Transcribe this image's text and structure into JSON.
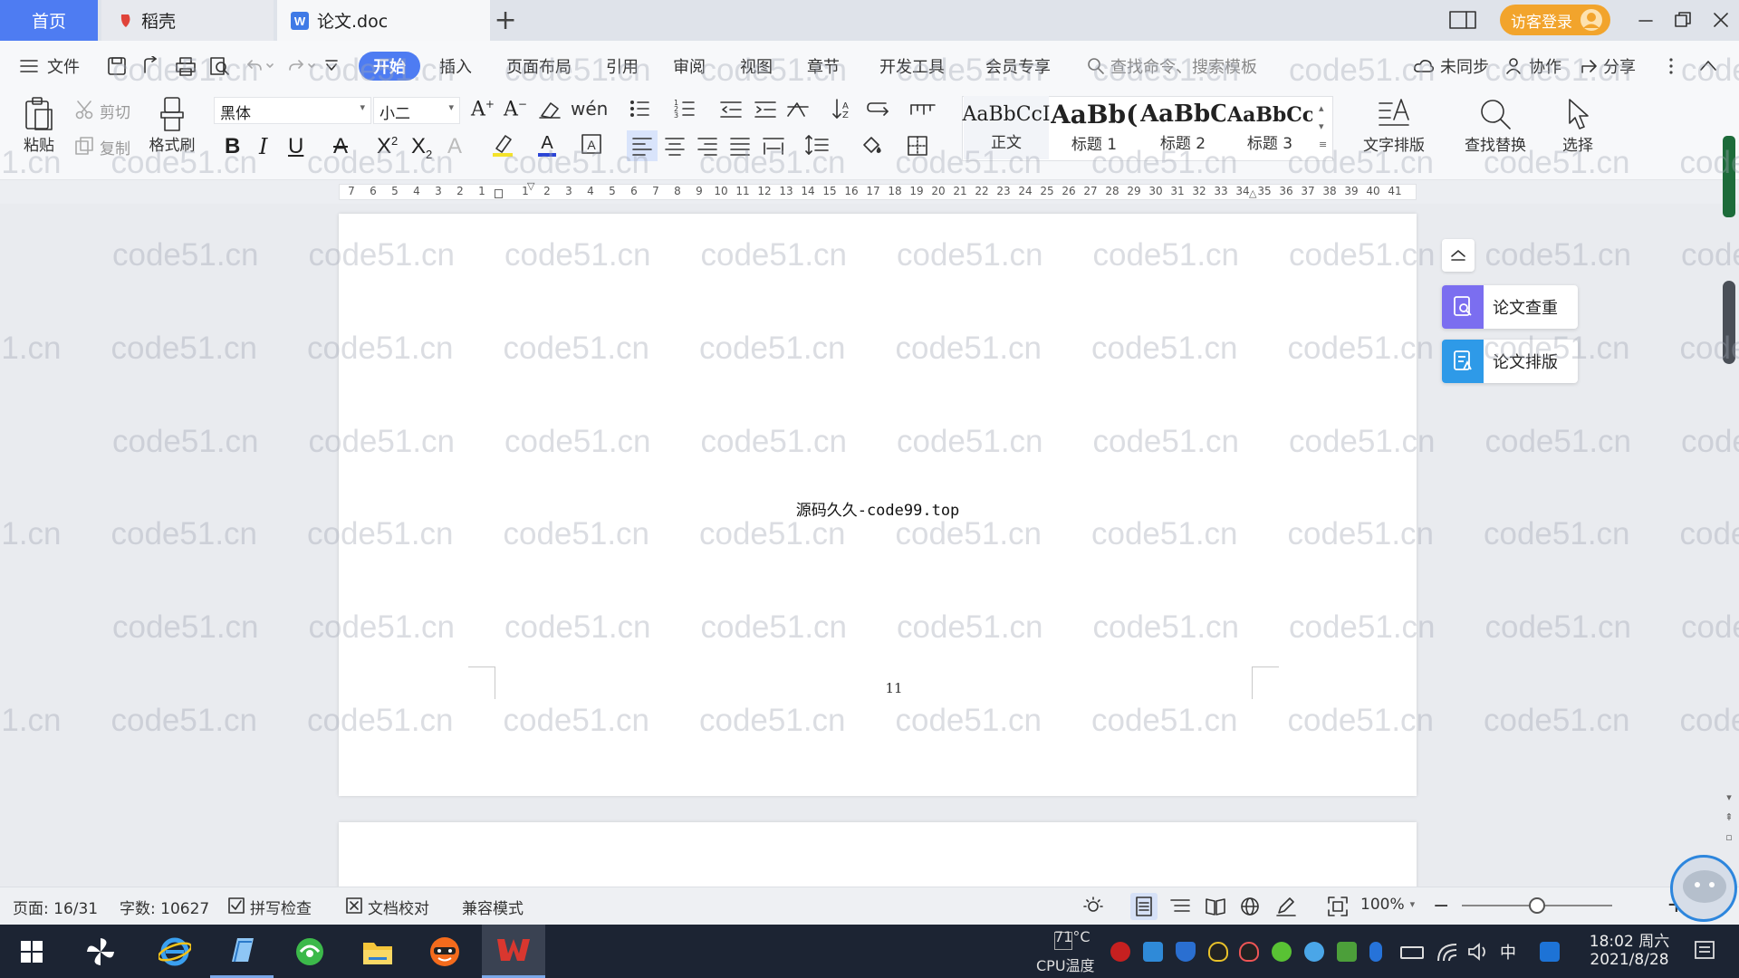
{
  "tabs": [
    {
      "label": "首页"
    },
    {
      "label": "稻壳"
    },
    {
      "label": "论文.doc"
    }
  ],
  "login_label": "访客登录",
  "menu": {
    "file": "文件",
    "items": [
      "开始",
      "插入",
      "页面布局",
      "引用",
      "审阅",
      "视图",
      "章节",
      "开发工具",
      "会员专享"
    ],
    "search_placeholder": "查找命令、搜索模板",
    "unsynced": "未同步",
    "collab": "协作",
    "share": "分享"
  },
  "ribbon": {
    "paste": "粘贴",
    "cut": "剪切",
    "copy": "复制",
    "format_painter": "格式刷",
    "font_name": "黑体",
    "font_size": "小二",
    "styles": [
      {
        "preview": "AaBbCcI",
        "name": "正文"
      },
      {
        "preview": "AaBb(",
        "name": "标题 1"
      },
      {
        "preview": "AaBbC",
        "name": "标题 2"
      },
      {
        "preview": "AaBbCcl",
        "name": "标题 3"
      }
    ],
    "text_layout": "文字排版",
    "find_replace": "查找替换",
    "select": "选择"
  },
  "ruler_ticks": [
    "7",
    "6",
    "5",
    "4",
    "3",
    "2",
    "1",
    "",
    "1",
    "2",
    "3",
    "4",
    "5",
    "6",
    "7",
    "8",
    "9",
    "10",
    "11",
    "12",
    "13",
    "14",
    "15",
    "16",
    "17",
    "18",
    "19",
    "20",
    "21",
    "22",
    "23",
    "24",
    "25",
    "26",
    "27",
    "28",
    "29",
    "30",
    "31",
    "32",
    "33",
    "34",
    "35",
    "36",
    "37",
    "38",
    "39",
    "40",
    "41"
  ],
  "document": {
    "line": "源码久久-code99.top",
    "page_number": "11"
  },
  "side_panel": {
    "check": "论文查重",
    "layout": "论文排版"
  },
  "status": {
    "page": "页面: 16/31",
    "words": "字数: 10627",
    "spell": "拼写检查",
    "proof": "文档校对",
    "compat": "兼容模式",
    "zoom": "100%",
    "zoom_level": 0.5
  },
  "taskbar": {
    "temp": "71°C",
    "cpu_label": "CPU温度",
    "ime": "中",
    "time": "18:02 周六",
    "date": "2021/8/28"
  },
  "watermark": "code51.cn",
  "colors": {
    "accent": "#4e7cf2",
    "login": "#f2a42c",
    "wps_red": "#d9372f"
  }
}
